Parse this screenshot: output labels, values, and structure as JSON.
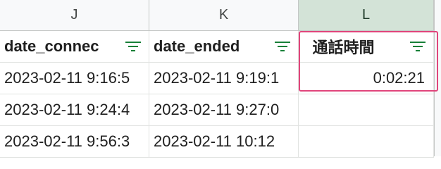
{
  "columns": [
    {
      "letter": "J",
      "header": "date_connec"
    },
    {
      "letter": "K",
      "header": "date_ended"
    },
    {
      "letter": "L",
      "header": "通話時間"
    }
  ],
  "rows": [
    [
      "2023-02-11 9:16:5",
      "2023-02-11 9:19:1",
      "0:02:21"
    ],
    [
      "2023-02-11 9:24:4",
      "2023-02-11 9:27:0",
      ""
    ],
    [
      "2023-02-11 9:56:3",
      "2023-02-11 10:12",
      ""
    ]
  ],
  "colors": {
    "filter_icon": "#188038",
    "selected_column_header": "#d3e3d7",
    "highlight_border": "#e0457b"
  },
  "icons": {
    "filter": "filter-icon"
  }
}
